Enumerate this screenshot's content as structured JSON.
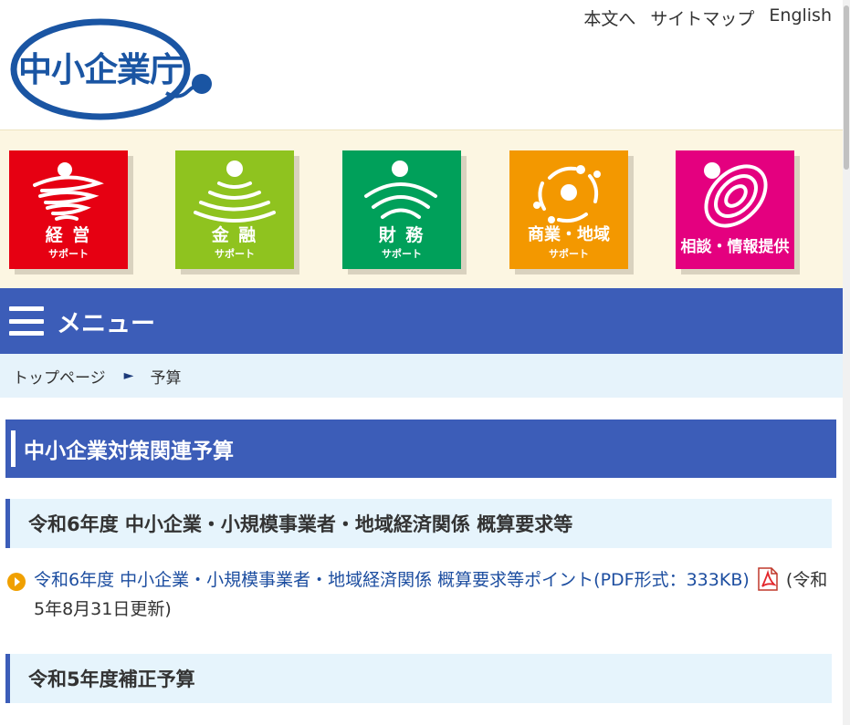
{
  "header": {
    "logo_text": "中小企業庁",
    "links": {
      "main_text": "本文へ",
      "sitemap": "サイトマップ",
      "english": "English"
    }
  },
  "categories": [
    {
      "id": "keiei",
      "label": "経 営",
      "sub": "サポート",
      "color": "#e60012"
    },
    {
      "id": "kinyu",
      "label": "金 融",
      "sub": "サポート",
      "color": "#8fc31f"
    },
    {
      "id": "zaimu",
      "label": "財 務",
      "sub": "サポート",
      "color": "#00a05a"
    },
    {
      "id": "shogyo",
      "label": "商業・地域",
      "sub": "サポート",
      "color": "#f39800"
    },
    {
      "id": "sodan",
      "label": "相談・情報提供",
      "sub": "",
      "color": "#e4007f"
    }
  ],
  "menu": {
    "label": "メニュー"
  },
  "breadcrumb": {
    "home": "トップページ",
    "separator": "►",
    "current": "予算"
  },
  "content": {
    "title": "中小企業対策関連予算",
    "sections": [
      {
        "heading": "令和6年度 中小企業・小規模事業者・地域経済関係 概算要求等",
        "items": [
          {
            "link_text": "令和6年度 中小企業・小規模事業者・地域経済関係 概算要求等ポイント(PDF形式：333KB)",
            "date_text": "(令和5年8月31日更新)"
          }
        ]
      },
      {
        "heading": "令和5年度補正予算",
        "items": []
      }
    ]
  },
  "colors": {
    "brand_blue": "#3c5db8",
    "logo_blue": "#1a55a3",
    "link_blue": "#1d4ea0",
    "bullet_orange": "#f0a000",
    "band_bg": "#fcf6e2",
    "light_blue_bg": "#e6f4fc"
  }
}
